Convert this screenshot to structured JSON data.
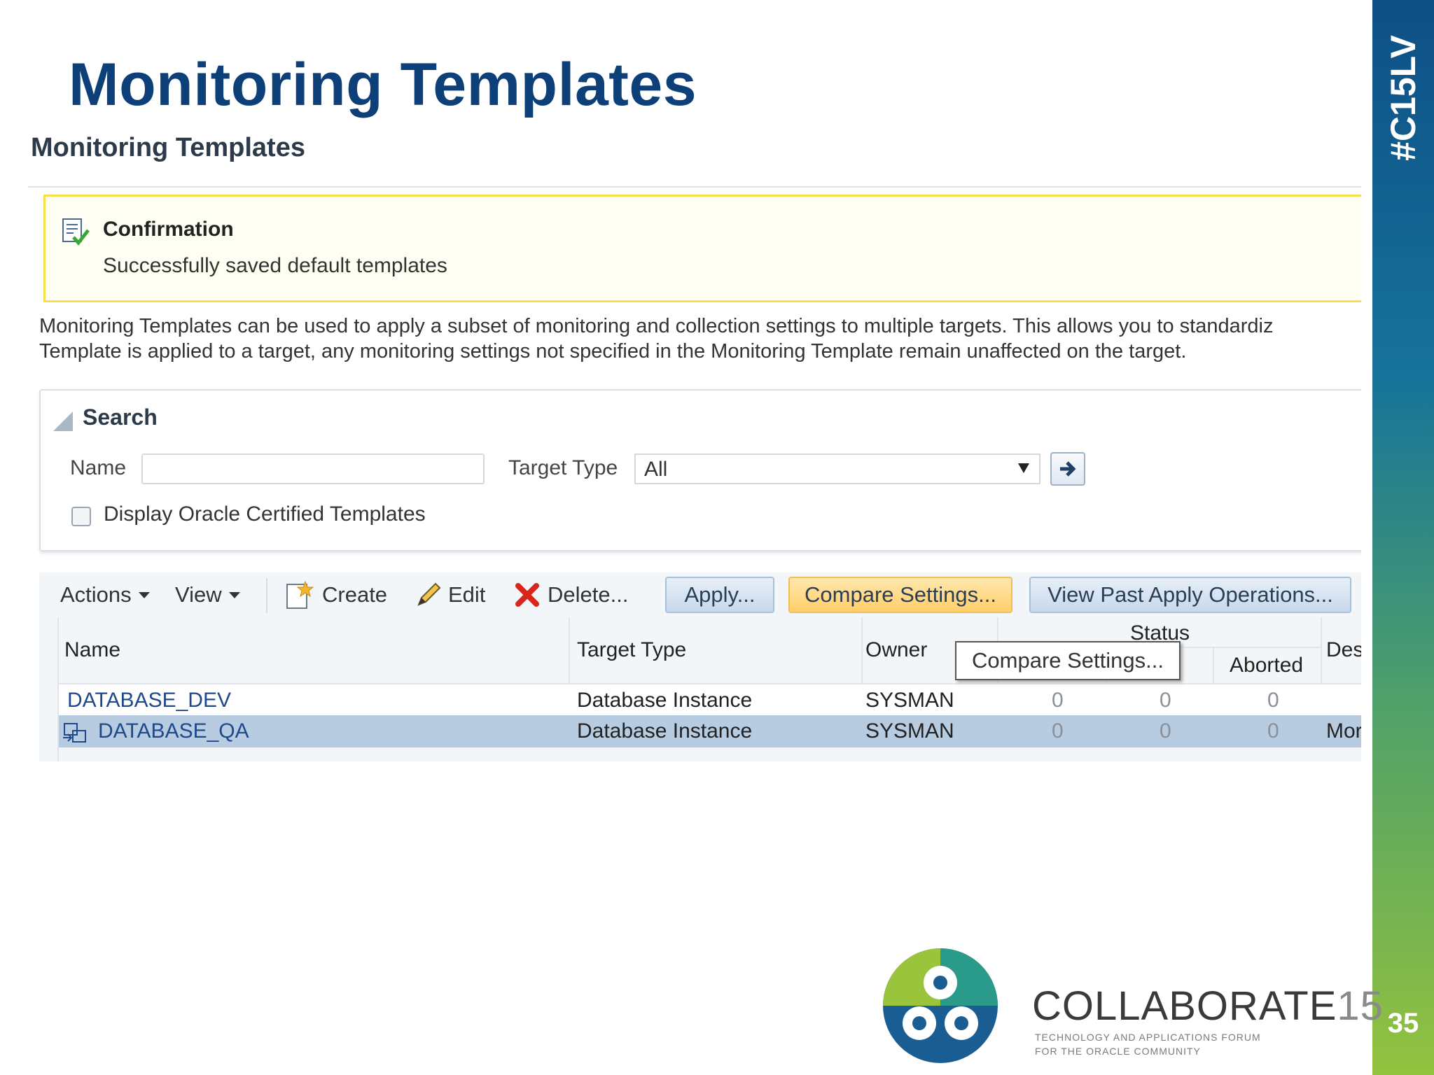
{
  "slide": {
    "title": "Monitoring Templates",
    "hashtag": "#C15LV",
    "page_number": "35"
  },
  "app": {
    "title": "Monitoring Templates",
    "confirmation": {
      "title": "Confirmation",
      "message": "Successfully saved default templates",
      "icon": "confirmation-check-icon"
    },
    "description": {
      "line1": "Monitoring Templates can be used to apply a subset of monitoring and collection settings to multiple targets. This allows you to standardiz",
      "line2": "Template is applied to a target, any monitoring settings not specified in the Monitoring Template remain unaffected on the target."
    },
    "search": {
      "title": "Search",
      "name_label": "Name",
      "name_value": "",
      "target_type_label": "Target Type",
      "target_type_value": "All",
      "checkbox_label": "Display Oracle Certified Templates",
      "checkbox_checked": false
    },
    "toolbar": {
      "actions": "Actions",
      "view": "View",
      "create": "Create",
      "edit": "Edit",
      "delete": "Delete...",
      "apply": "Apply...",
      "compare": "Compare Settings...",
      "view_past": "View Past Apply Operations..."
    },
    "table": {
      "headers": {
        "name": "Name",
        "target_type": "Target Type",
        "owner": "Owner",
        "status": "Status",
        "aborted": "Aborted",
        "description": "Des"
      },
      "rows": [
        {
          "name": "DATABASE_DEV",
          "target_type": "Database Instance",
          "owner": "SYSMAN",
          "s1": "0",
          "s2": "0",
          "s3": "0",
          "desc": ""
        },
        {
          "name": "DATABASE_QA",
          "target_type": "Database Instance",
          "owner": "SYSMAN",
          "s1": "0",
          "s2": "0",
          "s3": "0",
          "desc": "Mor"
        }
      ]
    },
    "tooltip": "Compare Settings..."
  },
  "branding": {
    "name_bold": "COLLABORATE",
    "name_light": "15",
    "tagline1": "TECHNOLOGY AND APPLICATIONS FORUM",
    "tagline2": "FOR THE ORACLE COMMUNITY"
  },
  "colors": {
    "title_blue": "#0d3f78",
    "confirm_border": "#f6e14c",
    "selected_row": "#b7cbe1",
    "compare_button": "#ffcf6a"
  }
}
